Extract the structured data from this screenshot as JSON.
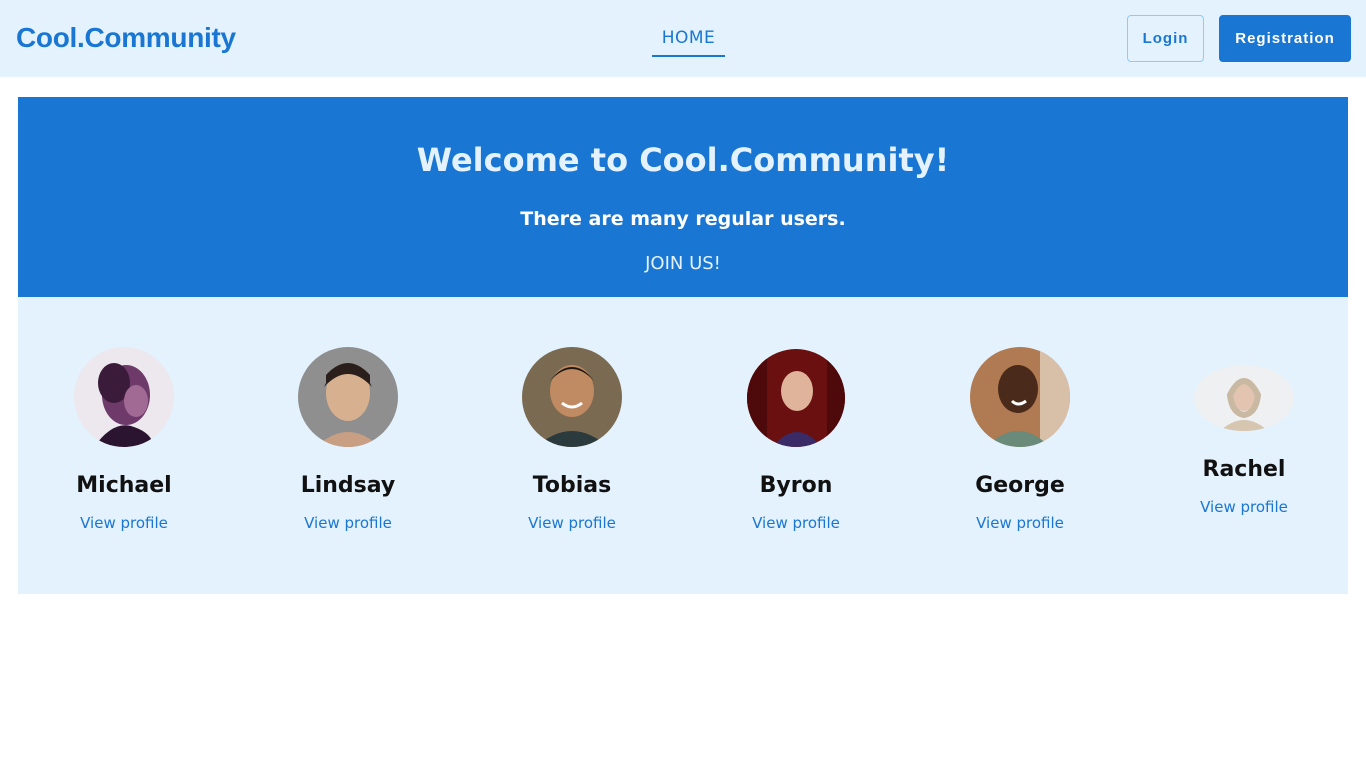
{
  "header": {
    "brand": "Cool.Community",
    "nav_home": "HOME",
    "login_label": "Login",
    "register_label": "Registration"
  },
  "hero": {
    "title": "Welcome to Cool.Community!",
    "subtitle": "There are many regular users.",
    "cta": "JOIN US!"
  },
  "users": [
    {
      "name": "Michael",
      "link": "View profile",
      "avatar_icon": "avatar-photo-purple"
    },
    {
      "name": "Lindsay",
      "link": "View profile",
      "avatar_icon": "avatar-photo-grey"
    },
    {
      "name": "Tobias",
      "link": "View profile",
      "avatar_icon": "avatar-photo-warm"
    },
    {
      "name": "Byron",
      "link": "View profile",
      "avatar_icon": "avatar-photo-red"
    },
    {
      "name": "George",
      "link": "View profile",
      "avatar_icon": "avatar-photo-brown"
    },
    {
      "name": "Rachel",
      "link": "View profile",
      "avatar_icon": "avatar-photo-snow"
    }
  ],
  "colors": {
    "primary": "#1976d2",
    "light": "#e3f2fd",
    "text": "#111111"
  }
}
